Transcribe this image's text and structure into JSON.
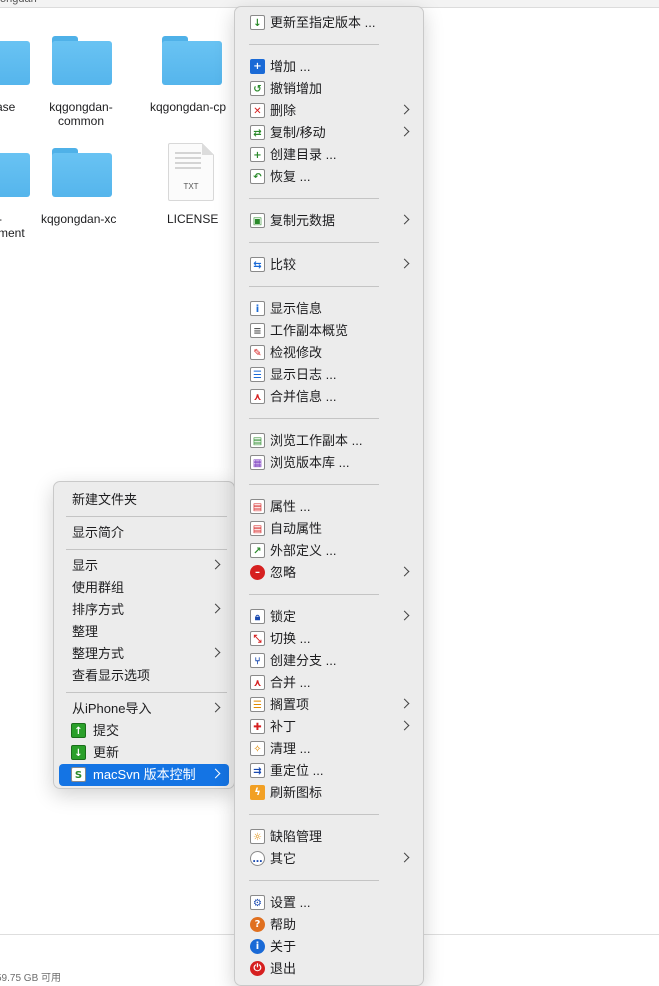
{
  "window": {
    "title": "ongdan"
  },
  "files": [
    {
      "name": "ase",
      "kind": "folder"
    },
    {
      "name": "kqgongdan-\ncommon",
      "kind": "folder"
    },
    {
      "name": "kqgongdan-cp",
      "kind": "folder"
    },
    {
      "name": "-\nment",
      "kind": "folder"
    },
    {
      "name": "kqgongdan-xc",
      "kind": "folder"
    },
    {
      "name": "LICENSE",
      "kind": "txt",
      "ext": "TXT"
    }
  ],
  "status": {
    "text": "59.75 GB 可用"
  },
  "context_menu": {
    "new_folder": "新建文件夹",
    "get_info": "显示简介",
    "show": "显示",
    "use_groups": "使用群组",
    "sort_by": "排序方式",
    "clean_up": "整理",
    "clean_up_by": "整理方式",
    "view_options": "查看显示选项",
    "import_iphone": "从iPhone导入",
    "commit": "提交",
    "update": "更新",
    "macsvn": "macSvn 版本控制"
  },
  "svn_menu": {
    "update_to_rev": "更新至指定版本 ...",
    "add": "增加 ...",
    "undo_add": "撤销增加",
    "delete": "删除",
    "copy_move": "复制/移动",
    "mkdir": "创建目录 ...",
    "revert": "恢复 ...",
    "copy_meta": "复制元数据",
    "compare": "比较",
    "show_info": "显示信息",
    "wc_overview": "工作副本概览",
    "check_mods": "检视修改",
    "show_log": "显示日志 ...",
    "merge_info": "合并信息 ...",
    "browse_wc": "浏览工作副本 ...",
    "browse_repo": "浏览版本库 ...",
    "properties": "属性 ...",
    "auto_props": "自动属性",
    "externals": "外部定义 ...",
    "ignore": "忽略",
    "lock": "锁定",
    "switch": "切换 ...",
    "branch": "创建分支 ...",
    "merge": "合并 ...",
    "shelve": "搁置项",
    "patch": "补丁",
    "cleanup": "清理 ...",
    "relocate": "重定位 ...",
    "refresh_icons": "刷新图标",
    "bug_tracking": "缺陷管理",
    "other": "其它",
    "settings": "设置 ...",
    "help": "帮助",
    "about": "关于",
    "quit": "退出"
  }
}
